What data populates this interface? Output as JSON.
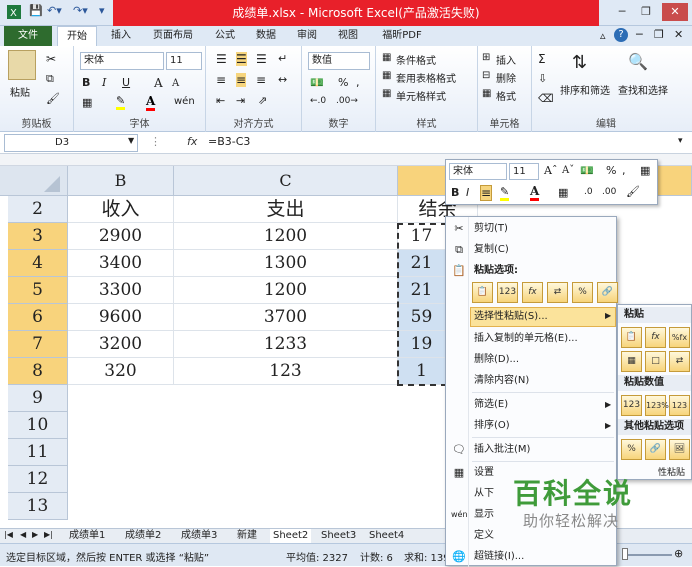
{
  "window": {
    "title": "成绩单.xlsx - Microsoft Excel(产品激活失败)"
  },
  "ribbon_tabs": [
    "文件",
    "开始",
    "插入",
    "页面布局",
    "公式",
    "数据",
    "审阅",
    "视图",
    "福昕PDF"
  ],
  "ribbon": {
    "clipboard": {
      "label": "剪贴板",
      "paste": "粘贴"
    },
    "font": {
      "label": "字体",
      "name": "宋体",
      "size": "11",
      "bold": "B",
      "italic": "I",
      "underline": "U",
      "grow": "A",
      "shrink": "A",
      "fill_color": "#ffff00",
      "font_color": "#ff0000"
    },
    "alignment": {
      "label": "对齐方式"
    },
    "number": {
      "label": "数字",
      "format": "数值",
      "percent": "%",
      "comma": ","
    },
    "styles": {
      "label": "样式",
      "cond_format": "条件格式",
      "table_format": "套用表格格式",
      "cell_styles": "单元格样式"
    },
    "cells": {
      "label": "单元格",
      "insert": "插入",
      "delete": "删除",
      "format": "格式"
    },
    "editing": {
      "label": "编辑",
      "sum": "Σ",
      "sort_filter": "排序和筛选",
      "find_select": "查找和选择"
    }
  },
  "formula_bar": {
    "name_box": "D3",
    "fx": "fx",
    "formula": "=B3-C3"
  },
  "sheet": {
    "columns": [
      "B",
      "C"
    ],
    "rows": [
      "2",
      "3",
      "4",
      "5",
      "6",
      "7",
      "8",
      "9",
      "10",
      "11",
      "12",
      "13"
    ],
    "headers": [
      "收入",
      "支出",
      "结余"
    ],
    "income": [
      "2900",
      "3400",
      "3300",
      "9600",
      "3200",
      "320"
    ],
    "expense": [
      "1200",
      "1300",
      "1200",
      "3700",
      "1233",
      "123"
    ],
    "balance_visible": [
      "17",
      "21",
      "21",
      "59",
      "19",
      "1"
    ]
  },
  "sheet_tabs": [
    "成绩单1",
    "成绩单2",
    "成绩单3",
    "新建",
    "Sheet2",
    "Sheet3",
    "Sheet4"
  ],
  "status": {
    "message": "选定目标区域，然后按 ENTER 或选择 “粘贴”",
    "average": "平均值: 2327",
    "count": "计数: 6",
    "sum": "求和: 139"
  },
  "mini_toolbar": {
    "font": "宋体",
    "size": "11",
    "percent": "%",
    "comma": ","
  },
  "context_menu": {
    "cut": "剪切(T)",
    "copy": "复制(C)",
    "paste_options_label": "粘贴选项:",
    "paste_special": "选择性粘贴(S)...",
    "insert_copied": "插入复制的单元格(E)...",
    "delete": "删除(D)...",
    "clear": "清除内容(N)",
    "filter": "筛选(E)",
    "sort": "排序(O)",
    "insert_comment": "插入批注(M)",
    "format_cells": "设置",
    "pick_list": "从下",
    "show_pinyin": "显示",
    "define_name": "定义",
    "hyperlink": "超链接(I)..."
  },
  "submenu": {
    "paste": "粘贴",
    "paste_values": "粘贴数值",
    "other": "其他粘贴选项",
    "more": "性粘贴"
  },
  "watermark": {
    "line1": "百科全说",
    "line2": "助你轻松解决"
  }
}
